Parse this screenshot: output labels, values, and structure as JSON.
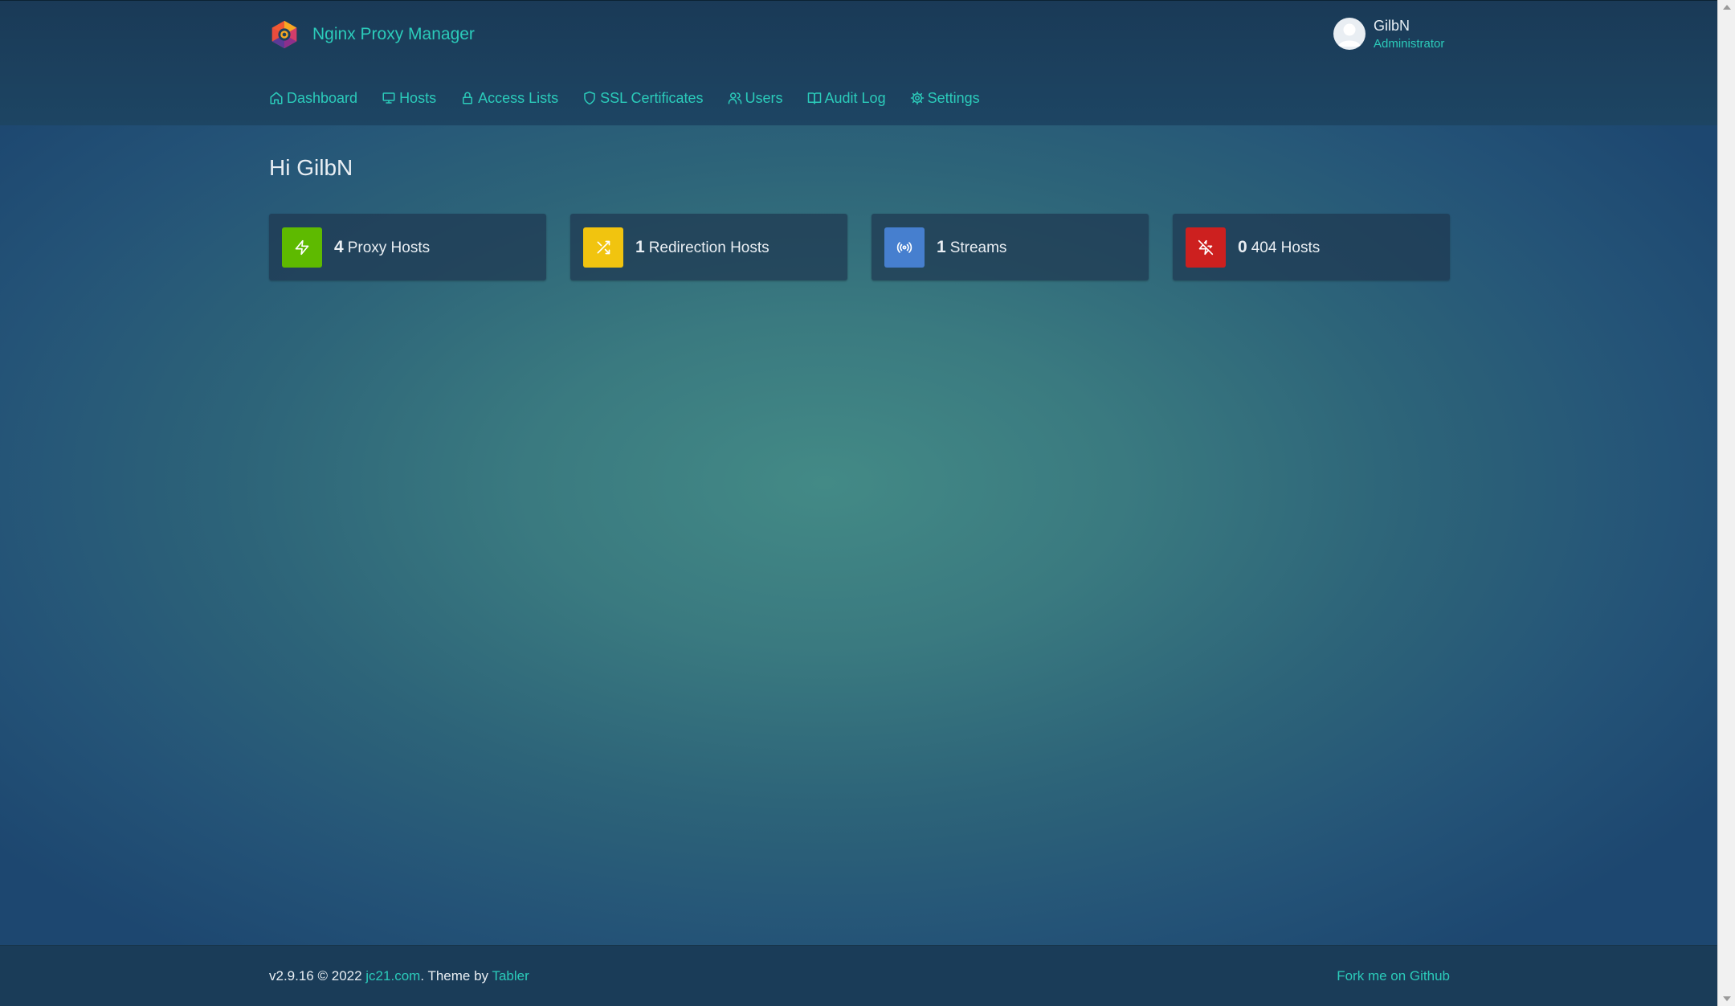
{
  "app": {
    "name": "Nginx Proxy Manager"
  },
  "user": {
    "name": "GilbN",
    "role": "Administrator"
  },
  "nav": {
    "items": [
      {
        "label": "Dashboard",
        "icon": "home-icon"
      },
      {
        "label": "Hosts",
        "icon": "monitor-icon"
      },
      {
        "label": "Access Lists",
        "icon": "lock-icon"
      },
      {
        "label": "SSL Certificates",
        "icon": "shield-icon"
      },
      {
        "label": "Users",
        "icon": "users-icon"
      },
      {
        "label": "Audit Log",
        "icon": "book-open-icon"
      },
      {
        "label": "Settings",
        "icon": "settings-icon"
      }
    ]
  },
  "main": {
    "greeting": "Hi GilbN",
    "cards": [
      {
        "count": "4",
        "label": "Proxy Hosts",
        "icon": "zap-icon",
        "color": "#5eba00"
      },
      {
        "count": "1",
        "label": "Redirection Hosts",
        "icon": "shuffle-icon",
        "color": "#f1c40f"
      },
      {
        "count": "1",
        "label": "Streams",
        "icon": "radio-icon",
        "color": "#467fcf"
      },
      {
        "count": "0",
        "label": "404 Hosts",
        "icon": "zap-off-icon",
        "color": "#cd201f"
      }
    ]
  },
  "footer": {
    "version": "v2.9.16 © 2022 ",
    "jc21_link": "jc21.com",
    "theme_text": ". Theme by ",
    "tabler_link": "Tabler",
    "fork_link": "Fork me on Github"
  },
  "colors": {
    "accent": "#2bcbba",
    "header_bg": "#1a3a57",
    "footer_bg": "#1a3c58"
  }
}
